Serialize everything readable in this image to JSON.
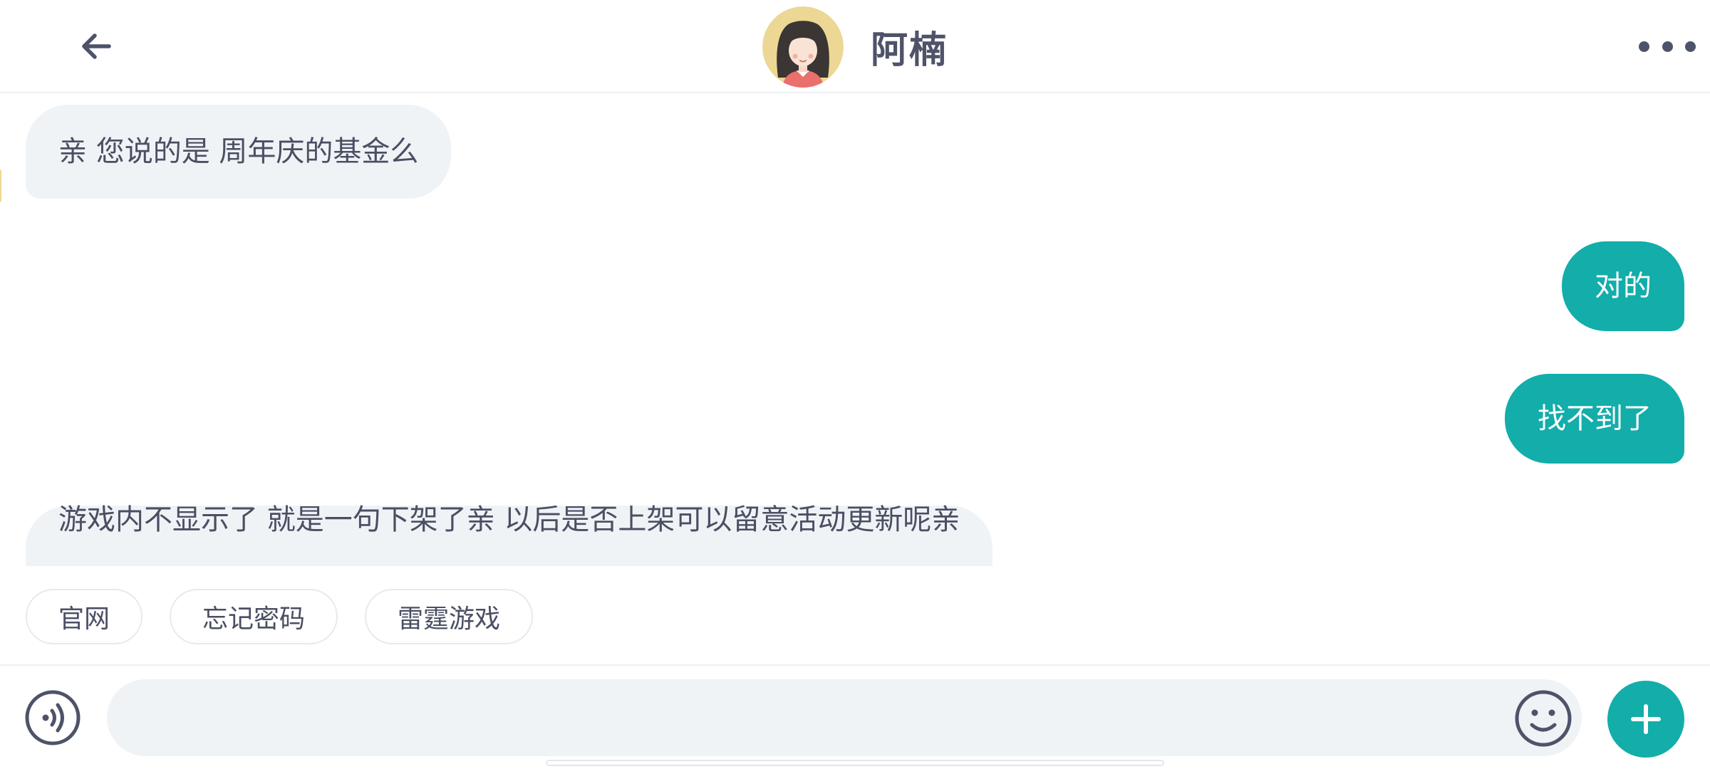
{
  "header": {
    "title": "阿楠",
    "back_icon": "arrow-left-icon",
    "more_icon": "more-horizontal-icon",
    "avatar": "agent-avatar"
  },
  "messages": [
    {
      "direction": "incoming",
      "text": "亲 您说的是 周年庆的基金么"
    },
    {
      "direction": "outgoing",
      "text": "对的"
    },
    {
      "direction": "outgoing",
      "text": "找不到了"
    },
    {
      "direction": "incoming",
      "text": "游戏内不显示了 就是一句下架了亲 以后是否上架可以留意活动更新呢亲"
    }
  ],
  "quick_replies": [
    "官网",
    "忘记密码",
    "雷霆游戏"
  ],
  "input": {
    "value": "",
    "placeholder": "",
    "voice_icon": "voice-icon",
    "emoji_icon": "emoji-smile-icon",
    "add_icon": "plus-icon"
  },
  "colors": {
    "accent": "#13adaa",
    "incoming_bubble": "#f0f3f6",
    "text": "#4a4f63"
  }
}
